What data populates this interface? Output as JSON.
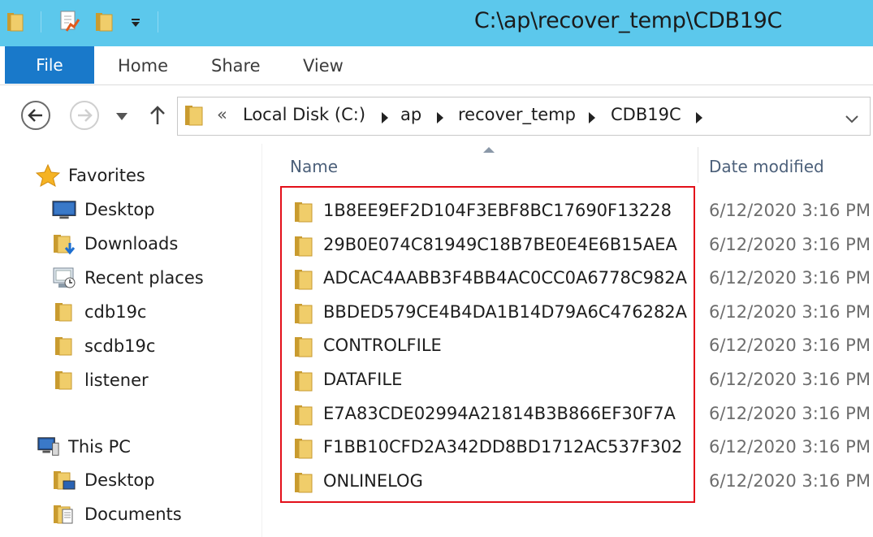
{
  "window": {
    "title": "C:\\ap\\recover_temp\\CDB19C"
  },
  "ribbon": {
    "tabs": [
      "File",
      "Home",
      "Share",
      "View"
    ]
  },
  "address": {
    "overflow": "«",
    "crumbs": [
      "Local Disk (C:)",
      "ap",
      "recover_temp",
      "CDB19C"
    ]
  },
  "nav_pane": {
    "favorites_label": "Favorites",
    "favorites": [
      "Desktop",
      "Downloads",
      "Recent places",
      "cdb19c",
      "scdb19c",
      "listener"
    ],
    "thispc_label": "This PC",
    "thispc": [
      "Desktop",
      "Documents"
    ]
  },
  "columns": {
    "name": "Name",
    "date": "Date modified"
  },
  "files": [
    {
      "name": "1B8EE9EF2D104F3EBF8BC17690F13228",
      "date": "6/12/2020 3:16 PM"
    },
    {
      "name": "29B0E074C81949C18B7BE0E4E6B15AEA",
      "date": "6/12/2020 3:16 PM"
    },
    {
      "name": "ADCAC4AABB3F4BB4AC0CC0A6778C982A",
      "date": "6/12/2020 3:16 PM"
    },
    {
      "name": "BBDED579CE4B4DA1B14D79A6C476282A",
      "date": "6/12/2020 3:16 PM"
    },
    {
      "name": "CONTROLFILE",
      "date": "6/12/2020 3:16 PM"
    },
    {
      "name": "DATAFILE",
      "date": "6/12/2020 3:16 PM"
    },
    {
      "name": "E7A83CDE02994A21814B3B866EF30F7A",
      "date": "6/12/2020 3:16 PM"
    },
    {
      "name": "F1BB10CFD2A342DD8BD1712AC537F302",
      "date": "6/12/2020 3:16 PM"
    },
    {
      "name": "ONLINELOG",
      "date": "6/12/2020 3:16 PM"
    }
  ],
  "colors": {
    "titlebar": "#5cc8ec",
    "file_tab": "#1979ca",
    "highlight_box": "#e3101a",
    "folder": "#e8c35a"
  }
}
